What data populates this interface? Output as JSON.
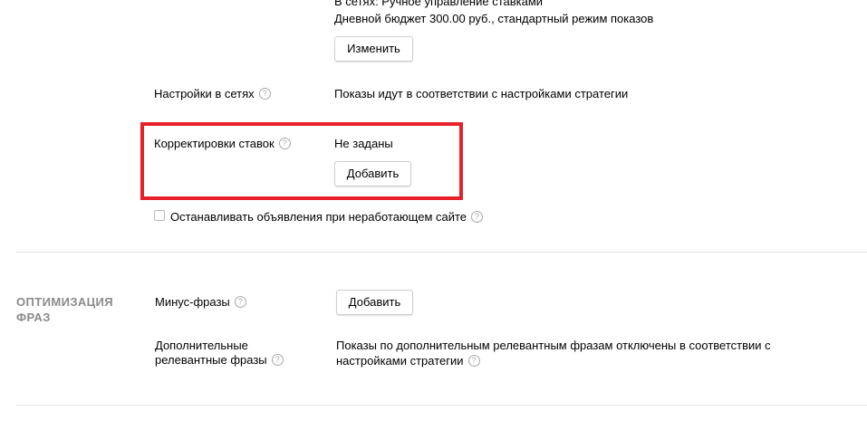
{
  "strategy": {
    "line1": "В сетях: Ручное управление ставками",
    "line2": "Дневной бюджет 300.00 руб., стандартный режим показов",
    "change_button": "Изменить"
  },
  "network_settings": {
    "label": "Настройки в сетях",
    "value": "Показы идут в соответствии с настройками стратегии"
  },
  "bid_adjustments": {
    "label": "Корректировки ставок",
    "value": "Не заданы",
    "add_button": "Добавить",
    "highlight_color": "#e8202a"
  },
  "stop_ads": {
    "label": "Останавливать объявления при неработающем сайте",
    "checked": false
  },
  "phrase_optimization": {
    "title": "ОПТИМИЗАЦИЯ ФРАЗ",
    "minus_phrases": {
      "label": "Минус-фразы",
      "add_button": "Добавить"
    },
    "extra_phrases": {
      "label_line1": "Дополнительные",
      "label_line2": "релевантные фразы",
      "value_line1": "Показы по дополнительным релевантным фразам отключены в соответствии с",
      "value_line2": "настройками стратегии"
    }
  },
  "help_icon_glyph": "?"
}
